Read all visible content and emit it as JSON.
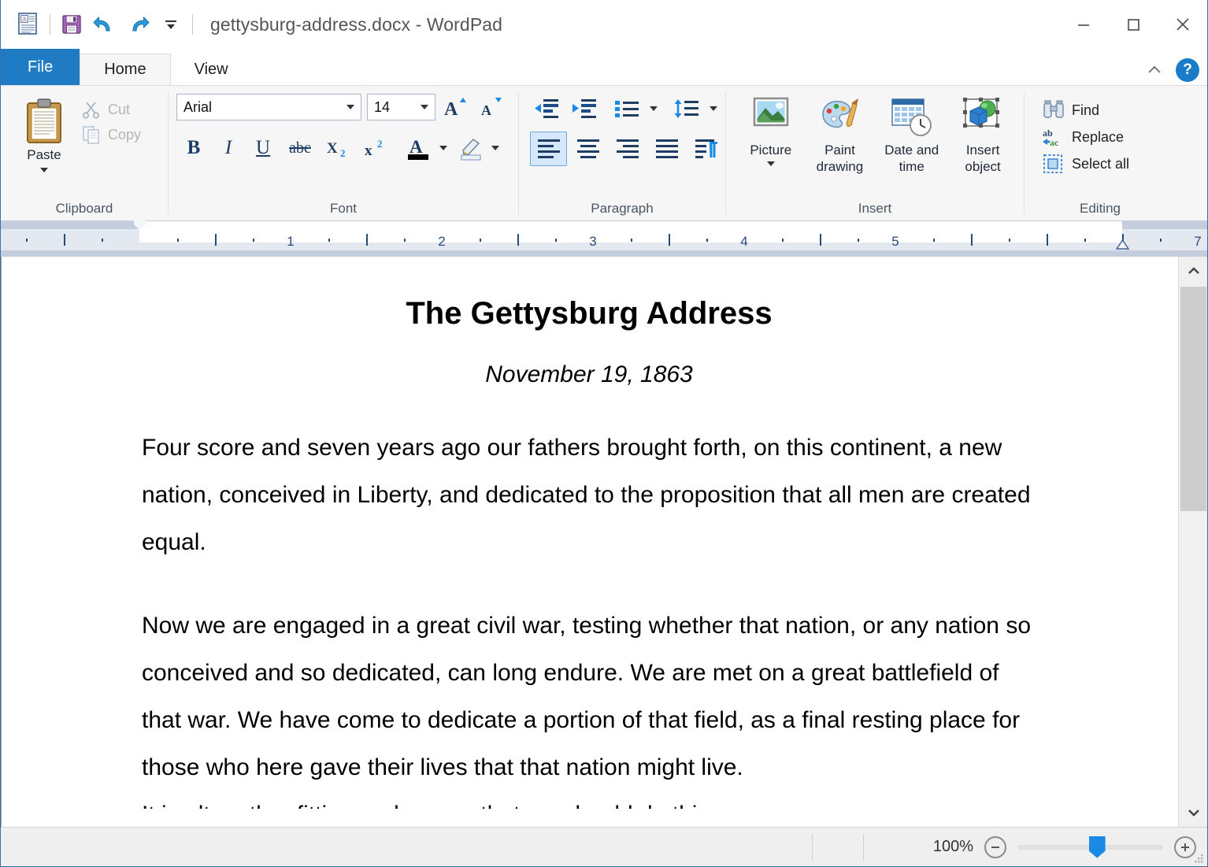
{
  "window": {
    "title": "gettysburg-address.docx - WordPad",
    "quick_access": [
      "wordpad-icon",
      "save-icon",
      "undo-icon",
      "redo-icon",
      "customize-qat-icon"
    ],
    "controls": {
      "minimize": "—",
      "maximize": "□",
      "close": "✕"
    }
  },
  "tabs": {
    "file": "File",
    "home": "Home",
    "view": "View",
    "collapse_icon": "chevron-up-icon",
    "help": "?"
  },
  "ribbon": {
    "clipboard": {
      "label": "Clipboard",
      "paste": "Paste",
      "cut": "Cut",
      "copy": "Copy"
    },
    "font": {
      "label": "Font",
      "family_value": "Arial",
      "size_value": "14",
      "grow": "A",
      "shrink": "A",
      "bold": "B",
      "italic": "I",
      "underline": "U",
      "strikethrough": "abc",
      "subscript": "X₂",
      "superscript": "x²",
      "text_color": "A",
      "highlight": "highlight-pen-icon"
    },
    "paragraph": {
      "label": "Paragraph",
      "decrease_indent": "decrease-indent-icon",
      "increase_indent": "increase-indent-icon",
      "bullets": "bullets-icon",
      "line_spacing": "line-spacing-icon",
      "align_left": "align-left-icon",
      "align_center": "align-center-icon",
      "align_right": "align-right-icon",
      "justify": "justify-icon",
      "paragraph_settings": "paragraph-settings-icon",
      "active_alignment": "align-left"
    },
    "insert": {
      "label": "Insert",
      "picture": "Picture",
      "paint_drawing": [
        "Paint",
        "drawing"
      ],
      "date_time": [
        "Date and",
        "time"
      ],
      "insert_object": [
        "Insert",
        "object"
      ]
    },
    "editing": {
      "label": "Editing",
      "find": "Find",
      "replace": "Replace",
      "select_all": "Select all"
    }
  },
  "ruler": {
    "numbers": [
      "1",
      "2",
      "3",
      "4",
      "5",
      "7"
    ],
    "unit_max": 7,
    "left_indent_in": 1.0,
    "right_indent_in": 6.5
  },
  "document": {
    "title": "The Gettysburg Address",
    "date": "November 19, 1863",
    "paragraphs": [
      "Four score and seven years ago our fathers brought forth, on this continent, a new nation, conceived in Liberty, and dedicated to the proposition that all men are created equal.",
      "Now we are engaged in a great civil war, testing whether that nation, or any nation so conceived and so dedicated, can long endure. We are met on a great battlefield of that war. We have come to dedicate a portion of that field, as a final resting place for those who here gave their lives that that nation might live.",
      "It is altogether fitting and proper that we should do this."
    ]
  },
  "statusbar": {
    "zoom_label": "100%",
    "zoom_out": "−",
    "zoom_in": "+",
    "zoom_percent": 100
  },
  "colors": {
    "file_tab": "#1e7bc4",
    "ribbon_bg": "#f6f6f6",
    "ruler_bg": "#c3cddd",
    "accent_blue": "#1a7bc9",
    "title_text": "#555555"
  }
}
